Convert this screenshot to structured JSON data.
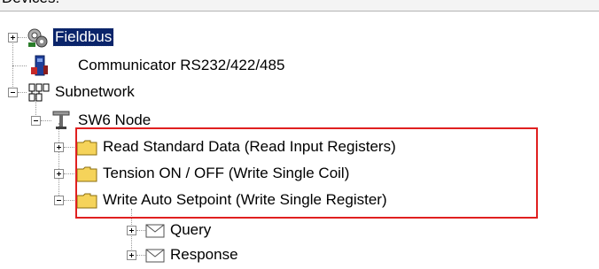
{
  "header": {
    "cut_label": "Devices:"
  },
  "tree": {
    "fieldbus": "Fieldbus",
    "communicator": "Communicator RS232/422/485",
    "subnetwork": "Subnetwork",
    "sw6_node": "SW6 Node",
    "read_standard": "Read Standard Data (Read Input Registers)",
    "tension": "Tension ON / OFF (Write Single Coil)",
    "write_auto": "Write Auto Setpoint (Write Single Register)",
    "query": "Query",
    "response": "Response"
  },
  "colors": {
    "highlight_box": "#e02020",
    "selection_bg": "#0a246a",
    "folder_yellow": "#f5d35a"
  }
}
